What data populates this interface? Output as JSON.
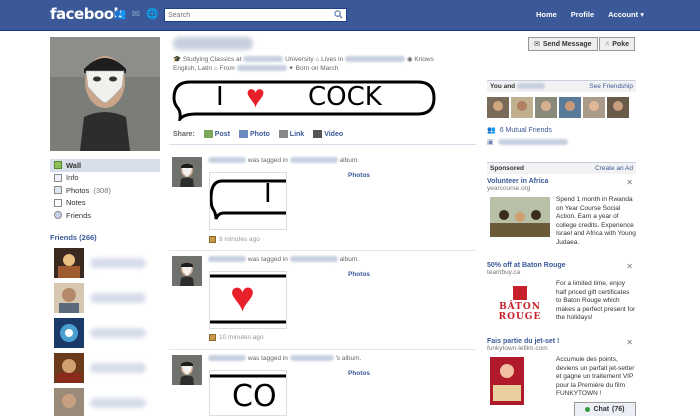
{
  "brand": {
    "logo": "facebook"
  },
  "topnav": {
    "search_placeholder": "Search",
    "home": "Home",
    "profile": "Profile",
    "account": "Account ▾"
  },
  "profile": {
    "info_studying": "Studying Classics at",
    "info_university": "University",
    "info_lives": "Lives in",
    "info_knows": "Knows",
    "info_languages": "English, Latin",
    "info_from": "From",
    "info_born": "Born on March",
    "send_message": "Send Message",
    "poke": "Poke",
    "bubble_i": "I",
    "bubble_heart": "♥",
    "bubble_word": "COCK"
  },
  "share": {
    "label": "Share:",
    "post": "Post",
    "photo": "Photo",
    "link": "Link",
    "video": "Video"
  },
  "leftnav": {
    "wall": "Wall",
    "info": "Info",
    "photos": "Photos",
    "photos_count": "(308)",
    "notes": "Notes",
    "friends": "Friends",
    "friends_header": "Friends (266)"
  },
  "feed": [
    {
      "was_tagged": "was tagged in",
      "album": "album.",
      "photos": "Photos",
      "time": "9 minutes ago",
      "image_text": "I"
    },
    {
      "was_tagged": "was tagged in",
      "album": "album.",
      "photos": "Photos",
      "time": "10 minutes ago",
      "image_text": "♥"
    },
    {
      "was_tagged": "was tagged in",
      "album": "'s album.",
      "photos": "Photos",
      "time": "",
      "image_text": "CO"
    }
  ],
  "rightcol": {
    "you_and": "You and",
    "see_friendship": "See Friendship",
    "mutual_friends": "6 Mutual Friends",
    "sponsored": "Sponsored",
    "create_ad": "Create an Ad"
  },
  "ads": [
    {
      "title": "Volunteer in Africa",
      "url": "yearcourse.org",
      "body": "Spend 1 month in Rwanda on Year Course Social Action. Earn a year of college credits. Experience Israel and Africa with Young Judaea."
    },
    {
      "title": "50% off at Baton Rouge",
      "url": "teambuy.ca",
      "body": "For a limited time, enjoy half priced gift certificates to Baton Rouge which makes a perfect present for the holidays!",
      "logo_line1": "BÂTON",
      "logo_line2": "ROUGE"
    },
    {
      "title": "Fais partie du jet-set !",
      "url": "funkytown-lefilm.com",
      "body": "Accumule des points, deviens un parfait jet-setter et gagne un traitement VIP pour la Première du film FUNKYTOWN !"
    }
  ],
  "chat": {
    "label": "Chat",
    "count": "(76)"
  },
  "colors": {
    "brand_blue": "#3b5998",
    "heart_red": "#e8202a"
  }
}
